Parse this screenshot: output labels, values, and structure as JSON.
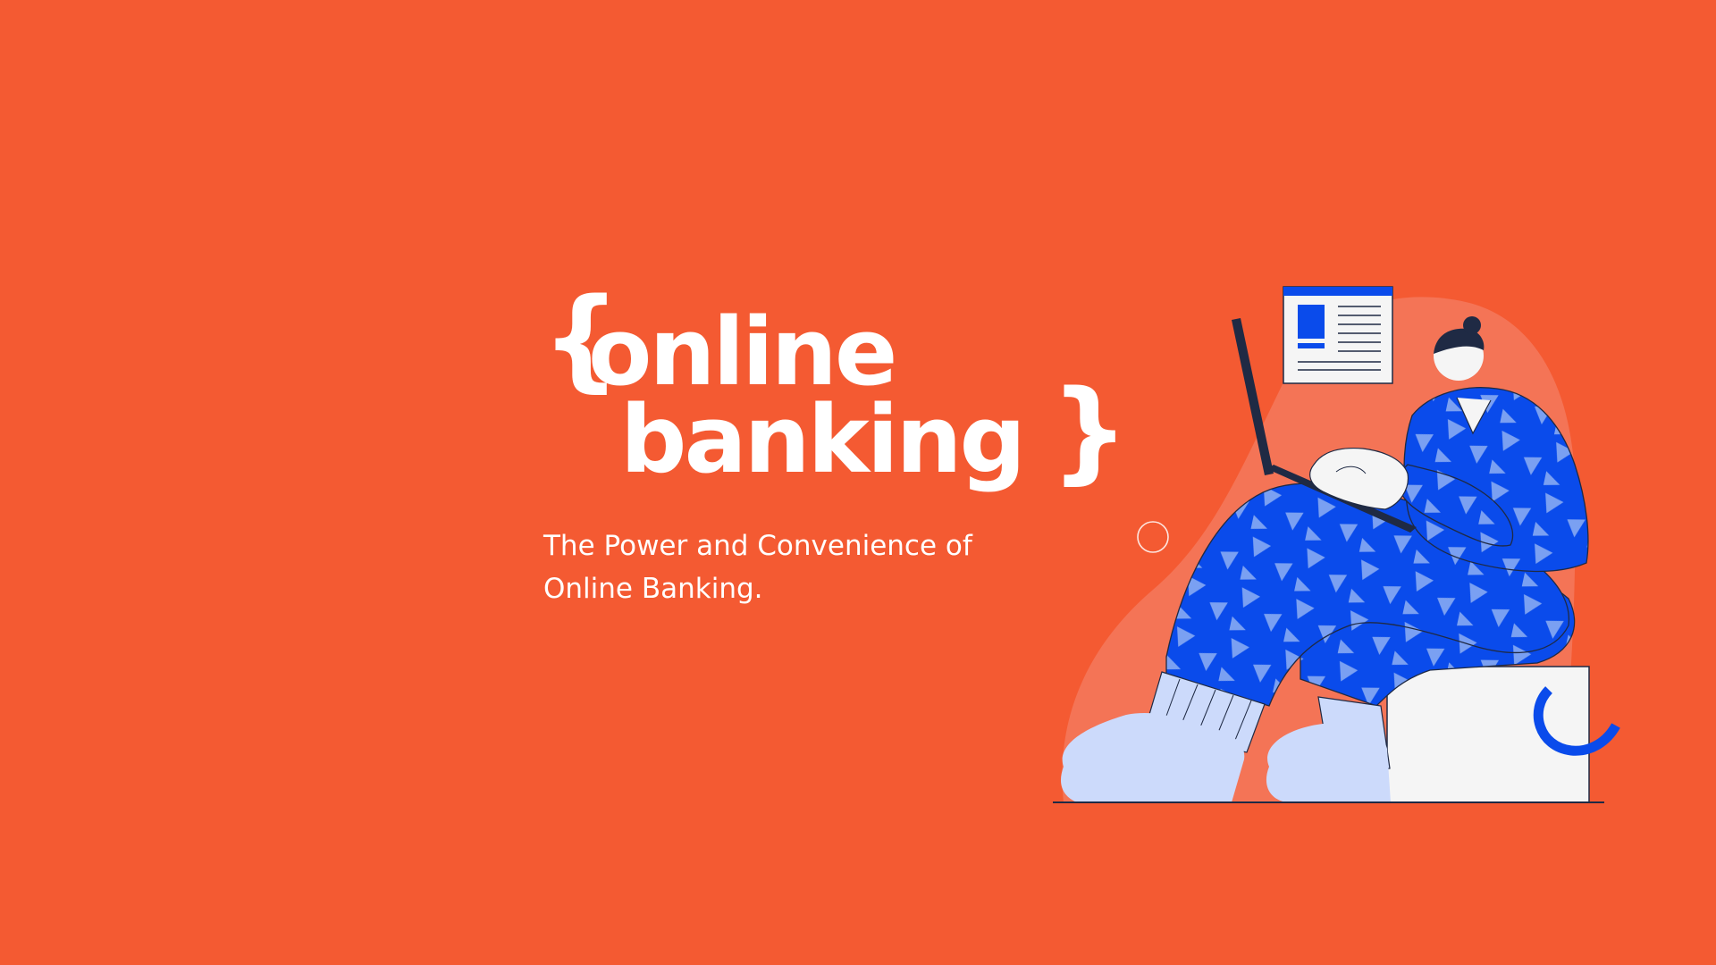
{
  "slide": {
    "title": {
      "brace_open": "{",
      "line1": "online",
      "line2": "banking",
      "brace_close": "}"
    },
    "subtitle": {
      "line1": "The Power and Convenience of",
      "line2": "Online Banking."
    }
  },
  "colors": {
    "background": "#F45A32",
    "blob": "#F47456",
    "text": "#FFFFFF",
    "pajama_blue": "#0A4BEB",
    "pattern_light": "#7AA0F2",
    "dark_navy": "#1F2A44",
    "sock": "#CCDAFB",
    "box": "#F5F5F5"
  },
  "illustration": {
    "icon": "person-with-laptop-illustration"
  }
}
